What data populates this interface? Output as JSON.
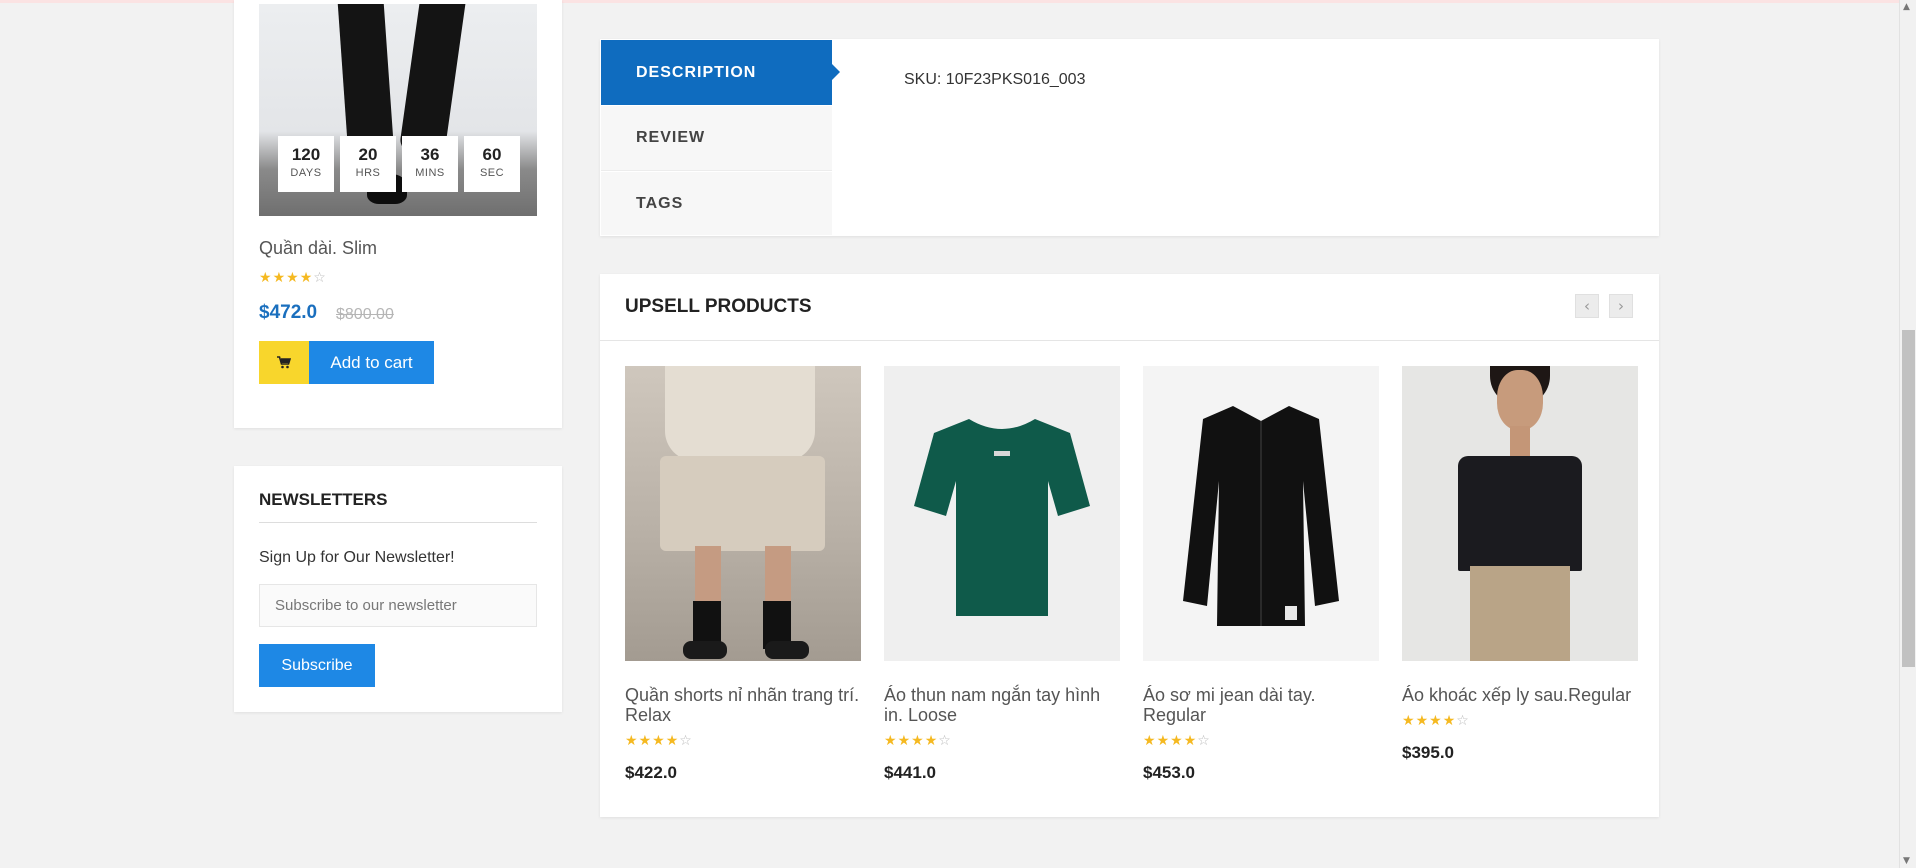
{
  "sidebar_product": {
    "countdown": [
      {
        "value": "120",
        "label": "DAYS"
      },
      {
        "value": "20",
        "label": "HRS"
      },
      {
        "value": "36",
        "label": "MINS"
      },
      {
        "value": "60",
        "label": "SEC"
      }
    ],
    "name": "Quần dài. Slim",
    "rating": 4,
    "price": "$472.0",
    "old_price": "$800.00",
    "add_to_cart_label": "Add to cart"
  },
  "newsletter": {
    "title": "NEWSLETTERS",
    "text": "Sign Up for Our Newsletter!",
    "placeholder": "Subscribe to our newsletter",
    "button_label": "Subscribe"
  },
  "tabs": {
    "items": [
      {
        "label": "DESCRIPTION",
        "active": true
      },
      {
        "label": "REVIEW",
        "active": false
      },
      {
        "label": "TAGS",
        "active": false
      }
    ],
    "sku": "SKU: 10F23PKS016_003"
  },
  "upsell": {
    "title": "UPSELL PRODUCTS",
    "prev_icon": "‹",
    "next_icon": "›",
    "products": [
      {
        "name": "Quần shorts nỉ nhãn trang trí. Relax",
        "rating": 4,
        "price": "$422.0"
      },
      {
        "name": "Áo thun nam ngắn tay hình in. Loose",
        "rating": 4,
        "price": "$441.0"
      },
      {
        "name": "Áo sơ mi jean dài tay. Regular",
        "rating": 4,
        "price": "$453.0"
      },
      {
        "name": "Áo khoác xếp ly sau.Regular",
        "rating": 4,
        "price": "$395.0"
      }
    ]
  },
  "colors": {
    "primary_blue": "#1e88e5",
    "tab_active": "#0f6cbf",
    "price_blue": "#1a6fbe",
    "cart_yellow": "#f8d62c",
    "star": "#f5b921"
  }
}
